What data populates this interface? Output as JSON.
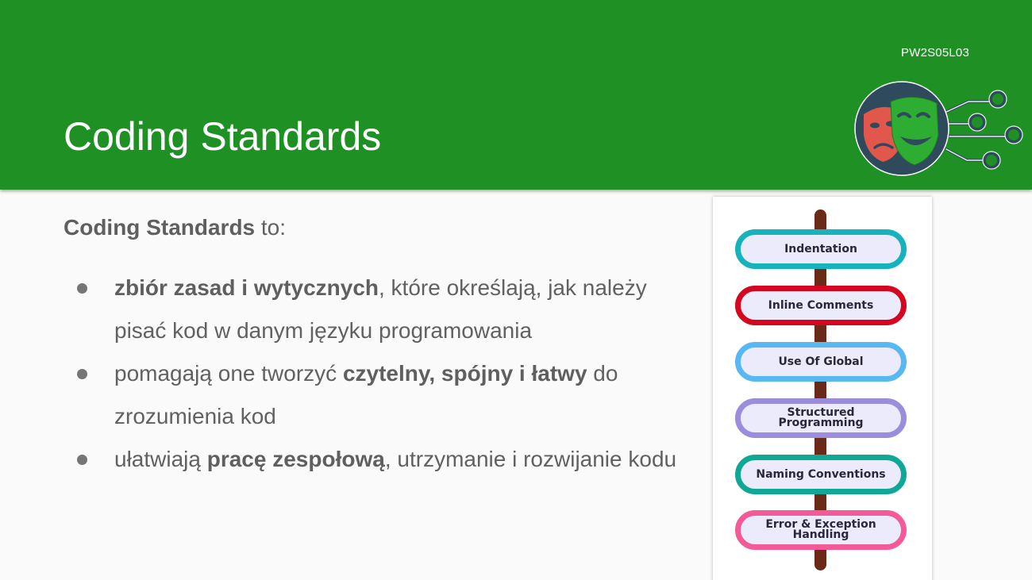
{
  "slide": {
    "code": "PW2S05L03",
    "title": "Coding Standards"
  },
  "intro": {
    "bold": "Coding Standards",
    "rest": " to:"
  },
  "bullets": [
    {
      "bold": "zbiór zasad i wytycznych",
      "after": ", które określają, jak należy pisać kod w danym języku programowania"
    },
    {
      "before": "pomagają one tworzyć ",
      "bold": "czytelny, spójny i łatwy",
      "after": " do zrozumienia kod"
    },
    {
      "before": "ułatwiają ",
      "bold": "pracę zespołową",
      "after": ", utrzymanie i rozwijanie kodu"
    }
  ],
  "signpost": {
    "signs": [
      {
        "label": "Indentation",
        "color": "#16b3bd"
      },
      {
        "label": "Inline Comments",
        "color": "#d5061f"
      },
      {
        "label": "Use Of Global",
        "color": "#57b8f2"
      },
      {
        "label": "Structured\nProgramming",
        "color": "#9b8ddb"
      },
      {
        "label": "Naming Conventions",
        "color": "#0fa896"
      },
      {
        "label": "Error & Exception\nHandling",
        "color": "#f25b97"
      }
    ]
  },
  "colors": {
    "header": "#1f9124",
    "text": "#616161",
    "pole": "#6a2a17"
  },
  "logo": {
    "icon": "theater-masks-circuit-icon"
  }
}
